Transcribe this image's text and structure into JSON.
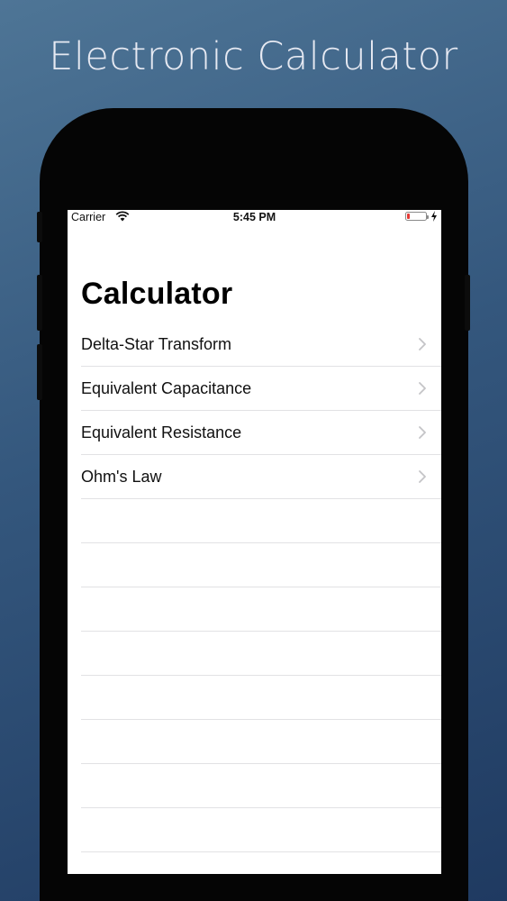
{
  "promo": {
    "title": "Electronic Calculator"
  },
  "status_bar": {
    "carrier": "Carrier",
    "time": "5:45 PM",
    "battery_color": "#e53935"
  },
  "nav": {
    "title": "Calculator"
  },
  "list": {
    "items": [
      {
        "label": "Delta-Star Transform",
        "icon": "chevron-right-icon"
      },
      {
        "label": "Equivalent Capacitance",
        "icon": "chevron-right-icon"
      },
      {
        "label": "Equivalent Resistance",
        "icon": "chevron-right-icon"
      },
      {
        "label": "Ohm's Law",
        "icon": "chevron-right-icon"
      }
    ]
  },
  "colors": {
    "background_top": "#4e7596",
    "background_bottom": "#1f3a61",
    "separator": "#e2e2e4",
    "chevron": "#c4c4c7"
  }
}
